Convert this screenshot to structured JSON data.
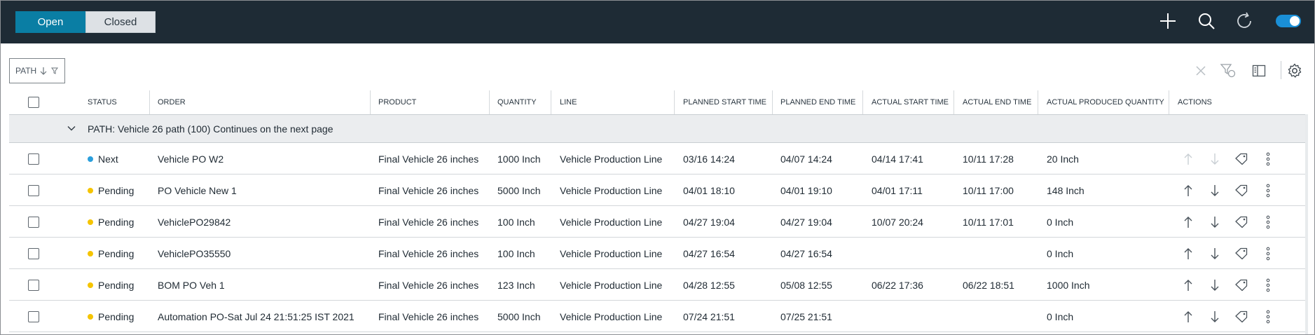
{
  "header": {
    "tabs": [
      {
        "label": "Open",
        "active": true
      },
      {
        "label": "Closed",
        "active": false
      }
    ],
    "icons": [
      "plus-icon",
      "search-icon",
      "refresh-icon",
      "toggle-switch"
    ],
    "colors": {
      "bar": "#1e2b35",
      "active_tab": "#0a7ea4",
      "toggle": "#1a8fd6"
    }
  },
  "toolbar": {
    "group_chip_label": "PATH",
    "icons": [
      "close-icon",
      "filter-clear-icon",
      "column-panel-icon",
      "settings-icon"
    ]
  },
  "table": {
    "columns": [
      "STATUS",
      "ORDER",
      "PRODUCT",
      "QUANTITY",
      "LINE",
      "PLANNED START TIME",
      "PLANNED END TIME",
      "ACTUAL START TIME",
      "ACTUAL END TIME",
      "ACTUAL PRODUCED QUANTITY",
      "ACTIONS"
    ],
    "group_label": "PATH: Vehicle 26 path (100) Continues on the next page",
    "status_colors": {
      "Next": "#2b9fdc",
      "Pending": "#f5c400"
    },
    "rows": [
      {
        "status": "Next",
        "order": "Vehicle PO W2",
        "product": "Final Vehicle 26 inches",
        "quantity": "1000 Inch",
        "line": "Vehicle Production Line",
        "planned_start": "03/16 14:24",
        "planned_end": "04/07 14:24",
        "actual_start": "04/14 17:41",
        "actual_end": "10/11 17:28",
        "produced": "20 Inch",
        "actions_enabled": false
      },
      {
        "status": "Pending",
        "order": "PO Vehicle New 1",
        "product": "Final Vehicle 26 inches",
        "quantity": "5000 Inch",
        "line": "Vehicle Production Line",
        "planned_start": "04/01 18:10",
        "planned_end": "04/01 19:10",
        "actual_start": "04/01 17:11",
        "actual_end": "10/11 17:00",
        "produced": "148 Inch",
        "actions_enabled": true
      },
      {
        "status": "Pending",
        "order": "VehiclePO29842",
        "product": "Final Vehicle 26 inches",
        "quantity": "100 Inch",
        "line": "Vehicle Production Line",
        "planned_start": "04/27 19:04",
        "planned_end": "04/27 19:04",
        "actual_start": "10/07 20:24",
        "actual_end": "10/11 17:01",
        "produced": "0 Inch",
        "actions_enabled": true
      },
      {
        "status": "Pending",
        "order": "VehiclePO35550",
        "product": "Final Vehicle 26 inches",
        "quantity": "100 Inch",
        "line": "Vehicle Production Line",
        "planned_start": "04/27 16:54",
        "planned_end": "04/27 16:54",
        "actual_start": "",
        "actual_end": "",
        "produced": "0 Inch",
        "actions_enabled": true
      },
      {
        "status": "Pending",
        "order": "BOM PO Veh 1",
        "product": "Final Vehicle 26 inches",
        "quantity": "123 Inch",
        "line": "Vehicle Production Line",
        "planned_start": "04/28 12:55",
        "planned_end": "05/08 12:55",
        "actual_start": "06/22 17:36",
        "actual_end": "06/22 18:51",
        "produced": "1000 Inch",
        "actions_enabled": true
      },
      {
        "status": "Pending",
        "order": "Automation PO-Sat Jul 24 21:51:25 IST 2021",
        "product": "Final Vehicle 26 inches",
        "quantity": "5000 Inch",
        "line": "Vehicle Production Line",
        "planned_start": "07/24 21:51",
        "planned_end": "07/25 21:51",
        "actual_start": "",
        "actual_end": "",
        "produced": "0 Inch",
        "actions_enabled": true
      }
    ]
  }
}
